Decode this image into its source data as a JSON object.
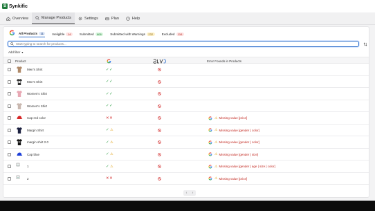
{
  "app": {
    "name": "Synkific"
  },
  "nav": [
    {
      "label": "Overview",
      "icon": "home-icon"
    },
    {
      "label": "Manage Products",
      "icon": "search-icon",
      "active": true
    },
    {
      "label": "Settings",
      "icon": "gear-icon"
    },
    {
      "label": "Plan",
      "icon": "card-icon"
    },
    {
      "label": "Help",
      "icon": "help-icon"
    }
  ],
  "filters": [
    {
      "label": "All Products",
      "count": "11",
      "bg": "#dfe7f7",
      "fg": "#2c4f8a"
    },
    {
      "label": "Ineligible",
      "count": "14",
      "bg": "#fde2e2",
      "fg": "#b42318"
    },
    {
      "label": "Submitted",
      "count": "606",
      "bg": "#d7f5dc",
      "fg": "#1e7a34"
    },
    {
      "label": "Submitted with Warnings",
      "count": "232",
      "bg": "#fdf0c8",
      "fg": "#8a6410"
    },
    {
      "label": "Excluded",
      "count": "116",
      "bg": "#fde2e2",
      "fg": "#b42318"
    }
  ],
  "search": {
    "placeholder": "Start typing to search for products..."
  },
  "add_filter": "Add filter",
  "table": {
    "headers": {
      "product": "Product",
      "errors": "Error Founds in Products"
    },
    "rows": [
      {
        "name": "Men's Shirt",
        "thumb": "shirt-tan",
        "google": "ok ok",
        "shopify": "ban",
        "errors": ""
      },
      {
        "name": "Men's Shirt",
        "thumb": "shirt-dark",
        "google": "ok ok",
        "shopify": "ban",
        "errors": ""
      },
      {
        "name": "Women's Shirt",
        "thumb": "shirt-pink",
        "google": "ok ok",
        "shopify": "ban",
        "errors": ""
      },
      {
        "name": "Women's Shirt",
        "thumb": "shirt-gray",
        "google": "ok ok",
        "shopify": "ban",
        "errors": ""
      },
      {
        "name": "Cap red color",
        "thumb": "cap-red",
        "google": "x x",
        "shopify": "ban",
        "errors": "Missing value [price]"
      },
      {
        "name": "Margin Shirt",
        "thumb": "shirt-navy",
        "google": "ok warn",
        "shopify": "ban",
        "errors": "Missing value [gender | color]"
      },
      {
        "name": "margin shirt 2.0",
        "thumb": "shirt-black",
        "google": "ok warn",
        "shopify": "ban",
        "errors": "Missing value [gender | color]"
      },
      {
        "name": "Cap blue",
        "thumb": "cap-blue",
        "google": "ok warn",
        "shopify": "ban",
        "errors": "Missing value [gender | size]"
      },
      {
        "name": "1",
        "thumb": "broken",
        "google": "ok warn",
        "shopify": "ban",
        "errors": "Missing value [gender | age | size | color]"
      },
      {
        "name": "2",
        "thumb": "broken",
        "google": "x x",
        "shopify": "ban",
        "errors": "Missing value [price]"
      }
    ]
  },
  "pager": {
    "prev": "‹",
    "next": "›"
  }
}
